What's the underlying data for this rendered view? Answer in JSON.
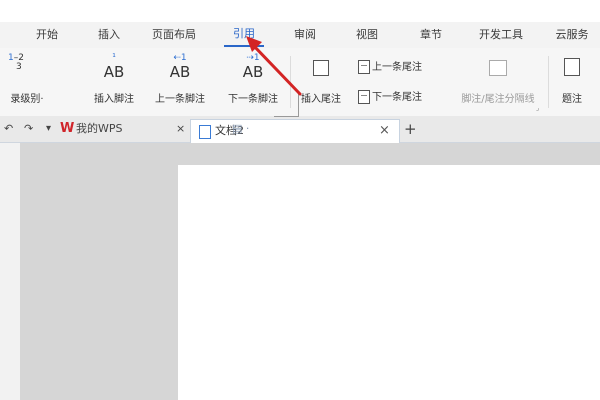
{
  "menu": {
    "tabs": [
      {
        "label": "开始"
      },
      {
        "label": "插入"
      },
      {
        "label": "页面布局"
      },
      {
        "label": "引用"
      },
      {
        "label": "审阅"
      },
      {
        "label": "视图"
      },
      {
        "label": "章节"
      },
      {
        "label": "开发工具"
      },
      {
        "label": "云服务"
      }
    ],
    "active_index": 3
  },
  "ribbon": {
    "toc_level": {
      "label": "录级别·",
      "icon_lines": [
        "1",
        "2",
        "3"
      ]
    },
    "insert_footnote": {
      "label": "插入脚注",
      "icon": "AB"
    },
    "prev_footnote": {
      "label": "上一条脚注",
      "icon": "AB"
    },
    "next_footnote": {
      "label": "下一条脚注",
      "icon": "AB"
    },
    "insert_endnote": {
      "label": "插入尾注"
    },
    "prev_endnote": {
      "label": "上一条尾注"
    },
    "next_endnote": {
      "label": "下一条尾注"
    },
    "separator_line": {
      "label": "脚注/尾注分隔线"
    },
    "caption": {
      "label": "题注"
    }
  },
  "tabstrip": {
    "undo": "↶",
    "redo": "↷",
    "dropdown": "▾",
    "wps_tab": "我的WPS",
    "wps_close": "×",
    "doc_tab": "文档2",
    "doc_close": "×",
    "new_tab": "+"
  },
  "colors": {
    "accent": "#2a66c8",
    "arrow": "#d32424"
  }
}
